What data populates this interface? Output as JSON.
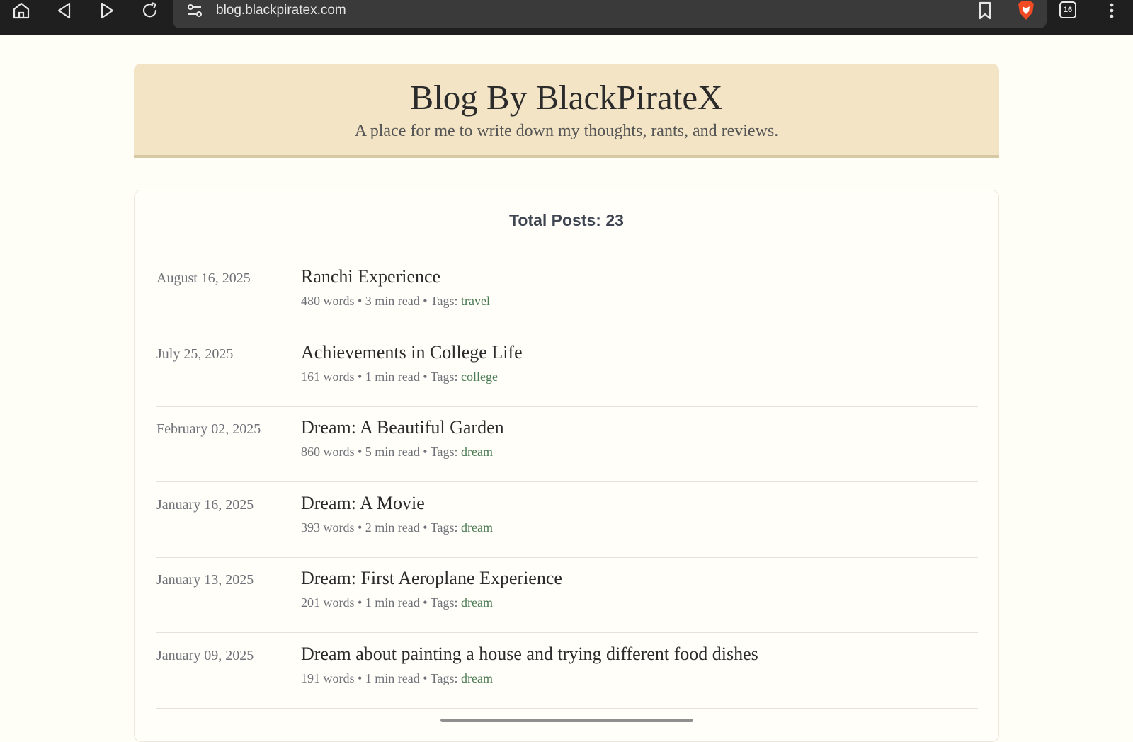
{
  "browser": {
    "url": "blog.blackpiratex.com",
    "tab_count": "16",
    "icons": [
      "home-icon",
      "back-icon",
      "forward-icon",
      "reload-icon",
      "site-settings-icon",
      "bookmark-icon",
      "brave-shield-icon",
      "tabs-icon",
      "more-menu-icon"
    ],
    "colors": {
      "toolbar": "#1f1f1f",
      "urlbar": "#3a3a3a",
      "shield": "#f04b23"
    }
  },
  "header": {
    "title": "Blog By BlackPirateX",
    "subtitle": "A place for me to write down my thoughts, rants, and reviews."
  },
  "summary": {
    "total_posts": "Total Posts: 23"
  },
  "posts": [
    {
      "date": "August 16, 2025",
      "title": "Ranchi Experience",
      "meta": "480 words • 3 min read • Tags: ",
      "tag": "travel"
    },
    {
      "date": "July 25, 2025",
      "title": "Achievements in College Life",
      "meta": "161 words • 1 min read • Tags: ",
      "tag": "college"
    },
    {
      "date": "February 02, 2025",
      "title": "Dream: A Beautiful Garden",
      "meta": "860 words • 5 min read • Tags: ",
      "tag": "dream"
    },
    {
      "date": "January 16, 2025",
      "title": "Dream: A Movie",
      "meta": "393 words • 2 min read • Tags: ",
      "tag": "dream"
    },
    {
      "date": "January 13, 2025",
      "title": "Dream: First Aeroplane Experience",
      "meta": "201 words • 1 min read • Tags: ",
      "tag": "dream"
    },
    {
      "date": "January 09, 2025",
      "title": "Dream about painting a house and trying different food dishes",
      "meta": "191 words • 1 min read • Tags: ",
      "tag": "dream"
    }
  ],
  "theme": {
    "page_bg": "#fefdf6",
    "header_bg": "#f2e4c5",
    "tag_color": "#4a7a52"
  }
}
